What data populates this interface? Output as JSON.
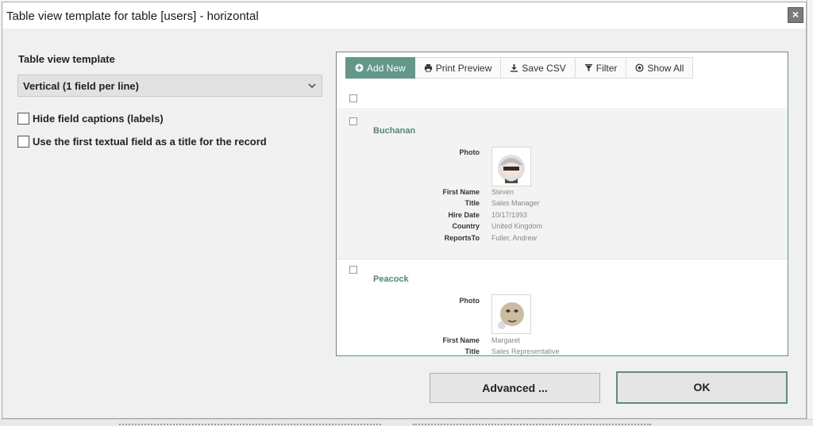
{
  "dialog": {
    "title": "Table view template for table [users] - horizontal",
    "close_symbol": "×"
  },
  "left_panel": {
    "template_label": "Table view template",
    "template_select_value": "Vertical (1 field per line)",
    "hide_captions_label": "Hide field captions (labels)",
    "hide_captions_checked": false,
    "first_field_title_label": "Use the first textual field as a title for the record",
    "first_field_title_checked": false
  },
  "preview": {
    "toolbar": {
      "add_new": "Add New",
      "print_preview": "Print Preview",
      "save_csv": "Save CSV",
      "filter": "Filter",
      "show_all": "Show All"
    },
    "records": [
      {
        "name": "Buchanan",
        "photo_label": "Photo",
        "fields": [
          {
            "label": "First Name",
            "value": "Steven"
          },
          {
            "label": "Title",
            "value": "Sales Manager"
          },
          {
            "label": "Hire Date",
            "value": "10/17/1993"
          },
          {
            "label": "Country",
            "value": "United Kingdom"
          },
          {
            "label": "ReportsTo",
            "value": "Fuller, Andrew"
          }
        ]
      },
      {
        "name": "Peacock",
        "photo_label": "Photo",
        "fields": [
          {
            "label": "First Name",
            "value": "Margaret"
          },
          {
            "label": "Title",
            "value": "Sales Representative"
          }
        ]
      }
    ]
  },
  "buttons": {
    "advanced": "Advanced ...",
    "ok": "OK"
  },
  "colors": {
    "accent": "#62978a",
    "record_name": "#4e8a77",
    "preview_border": "#6e8d80"
  }
}
